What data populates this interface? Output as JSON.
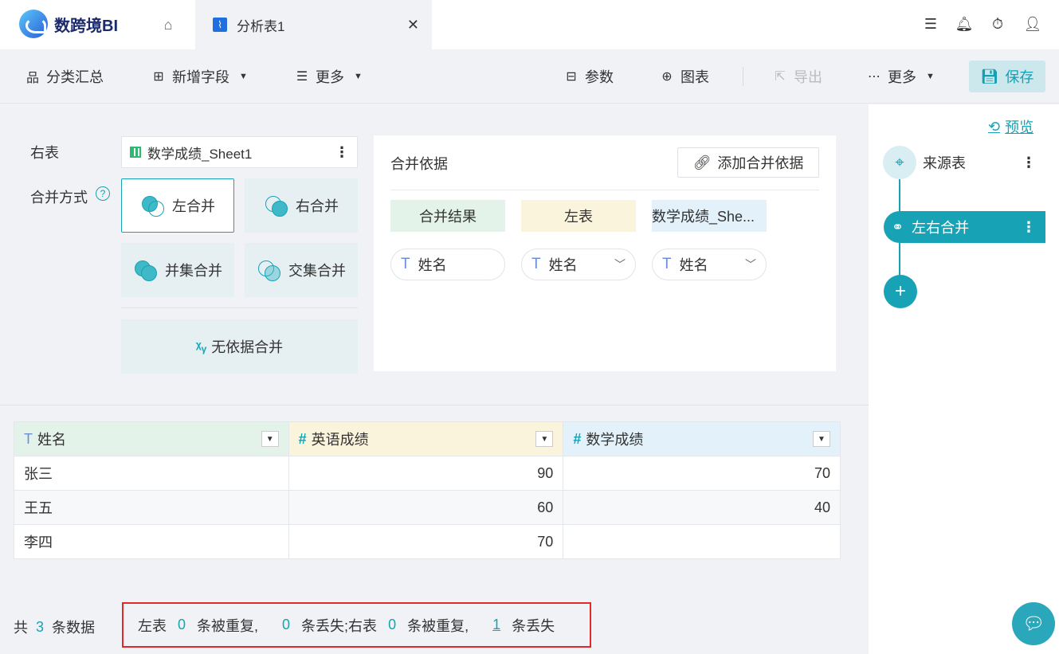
{
  "app": {
    "name": "数跨境BI"
  },
  "tabs": {
    "active_label": "分析表1"
  },
  "toolbar": {
    "category_summary": "分类汇总",
    "add_field": "新增字段",
    "more_left": "更多",
    "params": "参数",
    "chart": "图表",
    "export": "导出",
    "more_right": "更多",
    "save": "保存"
  },
  "merge_config": {
    "right_table_label": "右表",
    "right_table_value": "数学成绩_Sheet1",
    "merge_mode_label": "合并方式",
    "modes": [
      "左合并",
      "右合并",
      "并集合并",
      "交集合并"
    ],
    "no_basis": "无依据合并",
    "selected_mode": "左合并"
  },
  "basis": {
    "title": "合并依据",
    "add_button": "添加合并依据",
    "headers": [
      "合并结果",
      "左表",
      "数学成绩_She..."
    ],
    "fields": [
      "姓名",
      "姓名",
      "姓名"
    ]
  },
  "table": {
    "columns": [
      "姓名",
      "英语成绩",
      "数学成绩"
    ],
    "rows": [
      [
        "张三",
        "90",
        "70"
      ],
      [
        "王五",
        "60",
        "40"
      ],
      [
        "李四",
        "70",
        ""
      ]
    ]
  },
  "summary": {
    "prefix": "共",
    "count": "3",
    "suffix": "条数据",
    "left_label": "左表",
    "left_dup": "0",
    "dup_text": "条被重复,",
    "left_lost": "0",
    "lost_text_1": "条丢失;右表",
    "right_dup": "0",
    "dup_text_2": "条被重复,",
    "right_lost": "1",
    "lost_text_2": "条丢失"
  },
  "sidebar": {
    "preview": "预览",
    "source_node": "来源表",
    "merge_node": "左右合并"
  },
  "colors": {
    "accent": "#17a3b5",
    "highlight_border": "#e02a2a"
  }
}
